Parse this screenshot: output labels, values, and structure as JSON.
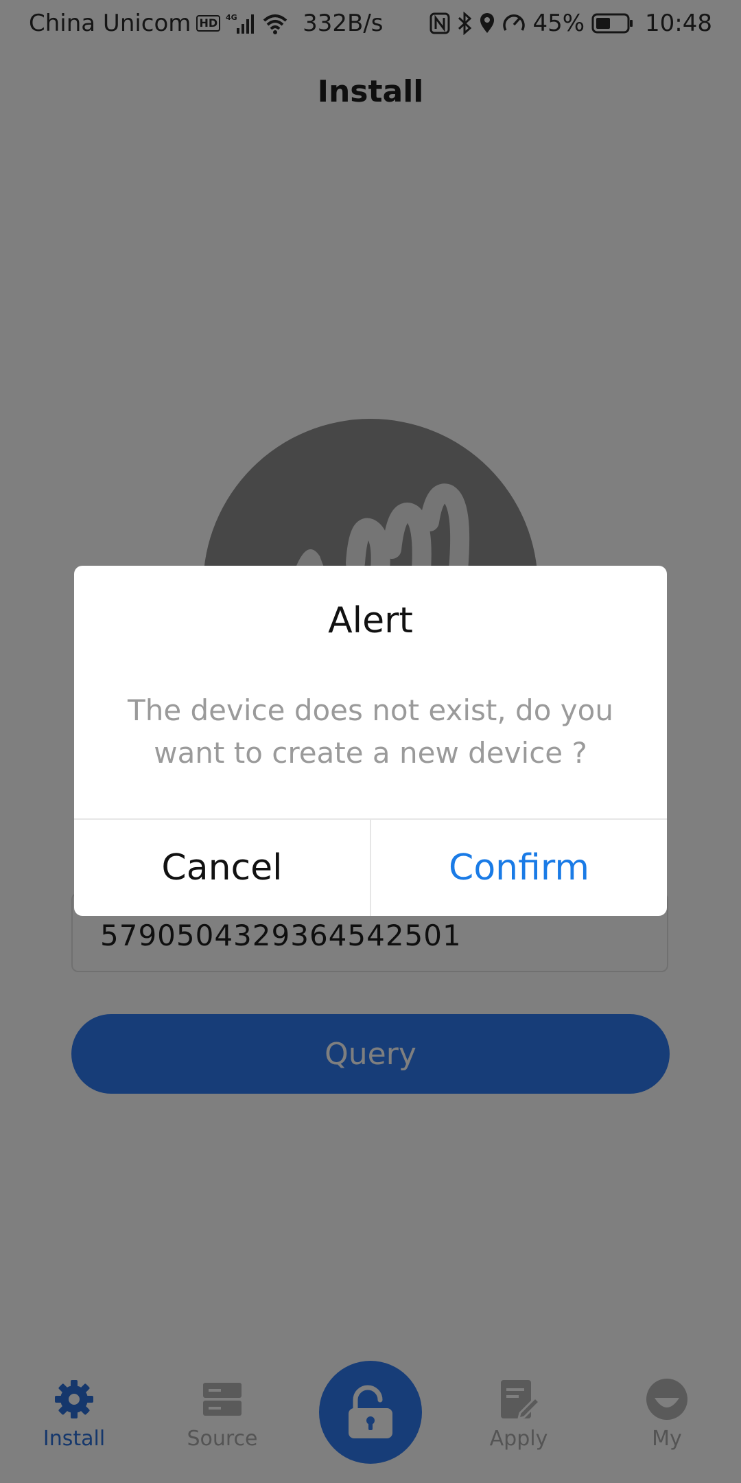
{
  "status_bar": {
    "carrier": "China Unicom",
    "hd": "HD",
    "network": "4G",
    "speed": "332B/s",
    "battery": "45%",
    "time": "10:48"
  },
  "header": {
    "title": "Install"
  },
  "main": {
    "device_id": "57905043293645425​01",
    "query_label": "Query"
  },
  "dialog": {
    "title": "Alert",
    "message": "The device does not exist, do you want to create a new device ?",
    "cancel_label": "Cancel",
    "confirm_label": "Confirm"
  },
  "bottom_nav": {
    "items": [
      {
        "label": "Install",
        "icon": "gear-icon",
        "active": true
      },
      {
        "label": "Source",
        "icon": "server-icon",
        "active": false
      },
      {
        "label": "",
        "icon": "unlock-icon",
        "active": false
      },
      {
        "label": "Apply",
        "icon": "edit-document-icon",
        "active": false
      },
      {
        "label": "My",
        "icon": "profile-icon",
        "active": false
      }
    ]
  },
  "colors": {
    "accent": "#2f7af1",
    "confirm_text": "#1a7be6",
    "overlay": "rgba(0,0,0,0.5)"
  }
}
